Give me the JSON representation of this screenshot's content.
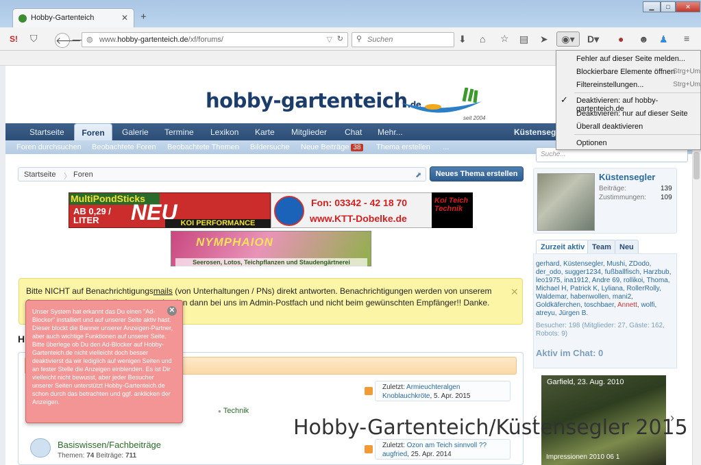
{
  "browser": {
    "tab_title": "Hobby-Gartenteich",
    "url_prefix": "www.",
    "url_domain": "hobby-gartenteich.de",
    "url_path": "/xf/forums/",
    "search_placeholder": "Suchen"
  },
  "site": {
    "logo": "hobby-gartenteich",
    "logo_tld": ".de",
    "since": "seit 2004"
  },
  "nav": {
    "tabs": [
      "Startseite",
      "Foren",
      "Galerie",
      "Termine",
      "Lexikon",
      "Karte",
      "Mitglieder",
      "Chat",
      "Mehr..."
    ],
    "active": "Foren",
    "user": "Küstensegler"
  },
  "subnav": {
    "items": [
      "Foren durchsuchen",
      "Beobachtete Foren",
      "Beobachtete Themen",
      "Bildersuche",
      "Neue Beiträge",
      "Thema erstellen",
      "..."
    ],
    "new_count": "38"
  },
  "breadcrumb": [
    "Startseite",
    "Foren"
  ],
  "new_thread_button": "Neues Thema erstellen",
  "ads": {
    "multipond_title": "MultiPondSticks",
    "multipond_price_1": "AB 0,29 /",
    "multipond_price_2": "LITER",
    "multipond_new": "NEU",
    "multipond_koi": "KOI PERFORMANCE",
    "ktt_phone": "Fon: 03342 - 42 18 70",
    "ktt_web": "www.KTT-Dobelke.de",
    "ktt_tag": "Koi Teich Technik",
    "nymphaion_name": "NYMPHAION",
    "nymphaion_sub": "Seerosen, Lotos, Teichpflanzen und Staudengärtnerei"
  },
  "notice": {
    "pre": "Bitte NICHT auf Benachrichtigungs",
    "link": "mails",
    "post": " (von Unterhaltungen / PNs) direkt antworten. Benachrichtigungen werden von unserem System verschickt und die Antworten landen dann bei uns im Admin-Postfach und nicht beim gewünschten Empfänger!! Danke. Das Admin-Team."
  },
  "forum_heading": "H",
  "adblock_popup": "Unser System hat erkannt das Du einen \"Ad-Blocker\" installiert und auf unserer Seite aktiv hast. Dieser blockt die Banner unserer Anzeigen-Partner, aber auch wichtige Funktionen auf unserer Seite. Bitte überlege ob Du den Ad-Blocker auf Hobby-Gartenteich.de nicht vielleicht doch besser deaktivierst da wir lediglich auf wenigen Seiten und an fester Stelle die Anzeigen einblenden. Es ist Dir vielleicht nicht bewusst, aber jeder Besucher unserer Seiten unterstützt Hobby-Gartenteich.de schon durch das betrachten und ggf. anklicken der Anzeigen.",
  "forums": [
    {
      "last_label": "Zuletzt:",
      "last_title": "Armieuchteralgen",
      "last_user": "Knoblauchkröte",
      "last_date": ", 5. Apr. 2015",
      "sub": "Technik"
    },
    {
      "title": "Basiswissen/Fachbeiträge",
      "stats_threads_label": "Themen:",
      "stats_threads": "74",
      "stats_posts_label": "Beiträge:",
      "stats_posts": "711",
      "last_label": "Zuletzt:",
      "last_title": "Ozon am Teich sinnvoll ??",
      "last_user": "augfried",
      "last_date": ", 25. Apr. 2014"
    }
  ],
  "sidebar": {
    "search_placeholder": "Suche...",
    "user": "Küstensegler",
    "posts_label": "Beiträge:",
    "posts": "139",
    "likes_label": "Zustimmungen:",
    "likes": "109",
    "tabs": [
      "Zurzeit aktiv",
      "Team",
      "Neu"
    ],
    "online_before": "gerhard, Küstensegler, Mushi, ZDodo, der_odo, sugger1234, fußballfisch, Harzbub, leo1975, ina1912, Andre 69, rollikoi, Thoma, Michael H, Patrick K, Lyliana, RollerRolly, Waldemar, habenwollen, mani2, Goldkäferchen, toschbaer, ",
    "online_red": "Annett",
    "online_after": ", wolfi, atreyu, Jürgen B.",
    "visitors": "Besucher: 198 (Mitglieder: 27, Gäste: 162, Robots: 9)",
    "chat": "Aktiv im Chat: 0",
    "photo_caption": "Garfield, 23. Aug. 2010",
    "photo_sub": "Impressionen 2010 06 1"
  },
  "overlay_text": "Hobby-Gartenteich/Küstensegler 2015",
  "menu": {
    "items": [
      {
        "label": "Fehler auf dieser Seite melden...",
        "shortcut": ""
      },
      {
        "label": "Blockierbare Elemente öffnen",
        "shortcut": "Strg+Um"
      },
      {
        "label": "Filtereinstellungen...",
        "shortcut": "Strg+Um"
      },
      {
        "label": "Deaktivieren: auf hobby-gartenteich.de",
        "shortcut": ""
      },
      {
        "label": "Deaktivieren: nur auf dieser Seite",
        "shortcut": ""
      },
      {
        "label": "Überall deaktivieren",
        "shortcut": ""
      },
      {
        "label": "Optionen",
        "shortcut": ""
      }
    ]
  }
}
